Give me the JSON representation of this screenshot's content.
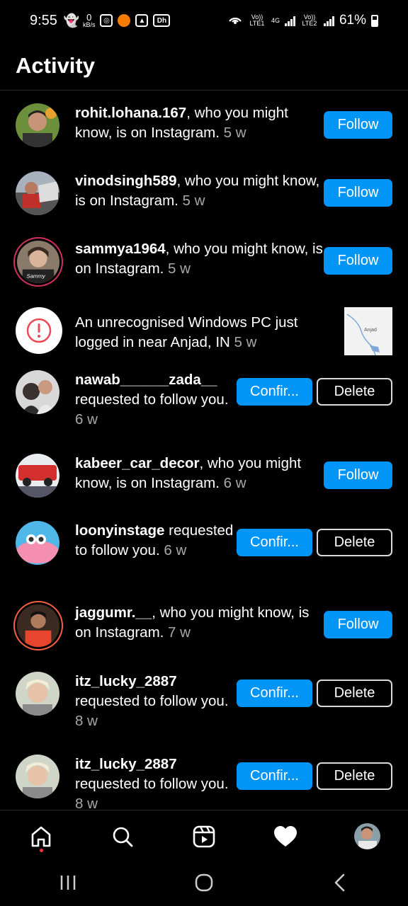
{
  "status_bar": {
    "time": "9:55",
    "speed_value": "0",
    "speed_unit": "kB/s",
    "network_1_label": "Vo)) LTE1",
    "network_type": "4G",
    "network_2_label": "Vo)) LTE2",
    "battery": "61%"
  },
  "header": {
    "title": "Activity"
  },
  "activities": [
    {
      "username": "rohit.lohana.167",
      "message": ", who you might know, is on Instagram.",
      "time": "5 w",
      "action": "Follow"
    },
    {
      "username": "vinodsingh589",
      "message": ", who you might know, is on Instagram.",
      "time": "5 w",
      "action": "Follow"
    },
    {
      "username": "sammya1964",
      "message": ", who you might know, is on Instagram.",
      "time": "5 w",
      "action": "Follow"
    },
    {
      "username": "",
      "message": "An unrecognised Windows PC just logged in near Anjad, IN",
      "time": "5 w",
      "map_label": "Anjad"
    },
    {
      "username": "nawab______zada__",
      "message": "requested to follow you.",
      "time": "6 w",
      "confirm": "Confir...",
      "delete": "Delete"
    },
    {
      "username": "kabeer_car_decor",
      "message": ", who you might know, is on Instagram.",
      "time": "6 w",
      "action": "Follow"
    },
    {
      "username": "loonyinstage",
      "message": "requested to follow you.",
      "time": "6 w",
      "confirm": "Confir...",
      "delete": "Delete"
    },
    {
      "username": "jaggumr.__",
      "message": ", who you might know, is on Instagram.",
      "time": "7 w",
      "action": "Follow"
    },
    {
      "username": "itz_lucky_2887",
      "message": "requested to follow you.",
      "time": "8 w",
      "confirm": "Confir...",
      "delete": "Delete"
    },
    {
      "username": "itz_lucky_2887",
      "message": "requested to follow you.",
      "time": "8 w",
      "confirm": "Confir...",
      "delete": "Delete"
    }
  ],
  "nav": {
    "home": "home-icon",
    "search": "search-icon",
    "reels": "reels-icon",
    "activity": "heart-icon",
    "profile": "profile-avatar"
  },
  "colors": {
    "accent": "#0095f6",
    "background": "#000000",
    "secondary_text": "#a8a8a8",
    "notification_dot": "#ff3040"
  }
}
